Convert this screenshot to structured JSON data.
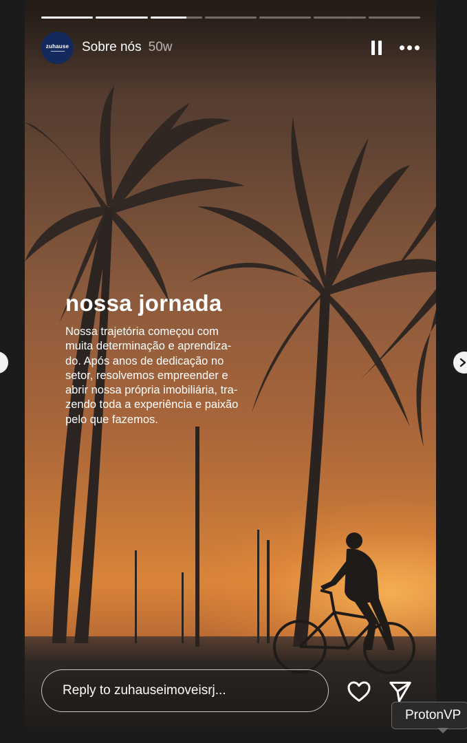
{
  "story": {
    "account_name": "Sobre nós",
    "time_ago": "50w",
    "avatar_logo_text": "zuhause",
    "progress": [
      1,
      1,
      0.7,
      0,
      0,
      0,
      0
    ],
    "heading": "nossa jornada",
    "body_lines": [
      "Nossa trajetória começou com",
      "muita determinação e aprendiza-",
      "do. Após anos de dedicação no",
      "setor, resolvemos empreender e",
      "abrir nossa própria imobiliária, tra-",
      "zendo toda a experiência e paixão",
      "pelo que fazemos."
    ]
  },
  "reply": {
    "placeholder": "Reply to zuhauseimoveisrj..."
  },
  "icons": {
    "pause": "pause-icon",
    "more": "more-icon",
    "heart": "heart-icon",
    "send": "send-icon",
    "next": "chevron-right-icon",
    "prev": "chevron-left-icon"
  },
  "tooltip": {
    "text": "ProtonVP"
  },
  "colors": {
    "avatar_bg": "#142a5c",
    "page_bg": "#1b1b1b"
  }
}
